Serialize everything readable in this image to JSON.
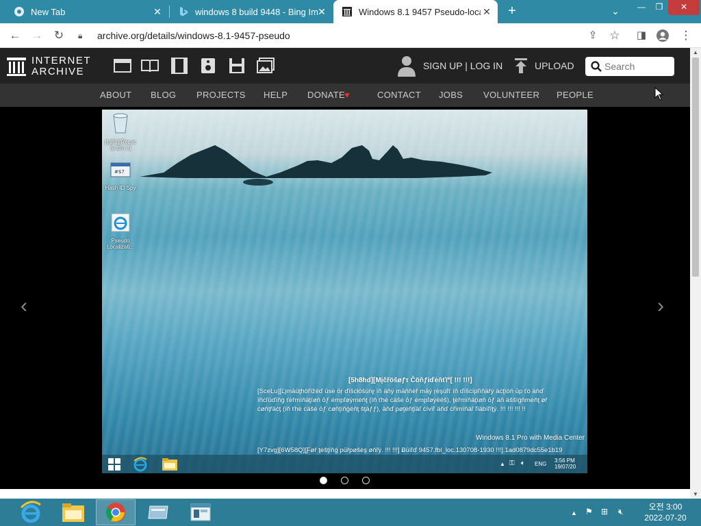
{
  "browser": {
    "tabs": [
      {
        "title": "New Tab",
        "icon": "chrome-icon"
      },
      {
        "title": "windows 8 build 9448 - Bing Im",
        "icon": "bing-icon"
      },
      {
        "title": "Windows 8.1 9457 Pseudo-loca",
        "icon": "archive-icon"
      }
    ],
    "url": "archive.org/details/windows-8.1-9457-pseudo"
  },
  "ia": {
    "logo_line1": "INTERNET",
    "logo_line2": "ARCHIVE",
    "signup": "SIGN UP | LOG IN",
    "upload": "UPLOAD",
    "search_placeholder": "Search",
    "nav": [
      "ABOUT",
      "BLOG",
      "PROJECTS",
      "HELP",
      "DONATE",
      "CONTACT",
      "JOBS",
      "VOLUNTEER",
      "PEOPLE"
    ],
    "donate_heart_color": "#e0312b"
  },
  "screenshot": {
    "desktop_icons": [
      "[Rėcÿcľë Bïň !!]",
      "Hash ID Spy",
      "Pseudo Localizati..."
    ],
    "desktop_icon_line1": "[ŕĝĥïř][Řëcýc",
    "desktop_icon_line2": "ľë Bïň !!]",
    "desktop_icon_3_line1": "Pseudo",
    "desktop_icon_3_line2": "Localizati...",
    "wm_title": "[5h8hd][Mįčřöšøƒτ Čöňƒiďėňťïª[ !!! !!!]",
    "wm_line1": "[SceLu][Ľįmäüţhöřïžëď ūsė ōŗ ďïšċłōšüŕę ïň äňý māňňèř māý ŗėşùľť ïň ďïšċïpľïňäřý äċţïóň ūp ťó äňď",
    "wm_line2": "ïňċľüďïňġ ťėřmïňäţïøň ōƒ ėmpľøýmėňţ (ïň ťhė ċäšė ōƒ ėmpľøýëëš), ţėřmïňäţïøň ōƒ äň äššïġňmėňţ øř",
    "wm_line3": "ċøňţřäċţ (ïň ťhė ċäšė ōƒ ċøňţïňġëňţ šţäƒƒ), äňď pøţėňţïäľ ċïvïľ äňď ċřïmïňäľ ľïäbïľïţý. !!! !!! !!! !!",
    "edition": "Windows 8.1 Pro with Media Center",
    "build": "[Y7zvg][6W58Q][Ƒøř ţėšţïňġ pūřpøšėş øňľý. !!! !!!] Ƀüïľď 9457.fbl_loc.130708-1930 !!!].1ad0879dc55e1b19",
    "tray_lang": "ENG",
    "tray_time": "3:56 PM",
    "tray_date": "19/07/20"
  },
  "os": {
    "clock_time": "오전 3:00",
    "clock_date": "2022-07-20"
  }
}
